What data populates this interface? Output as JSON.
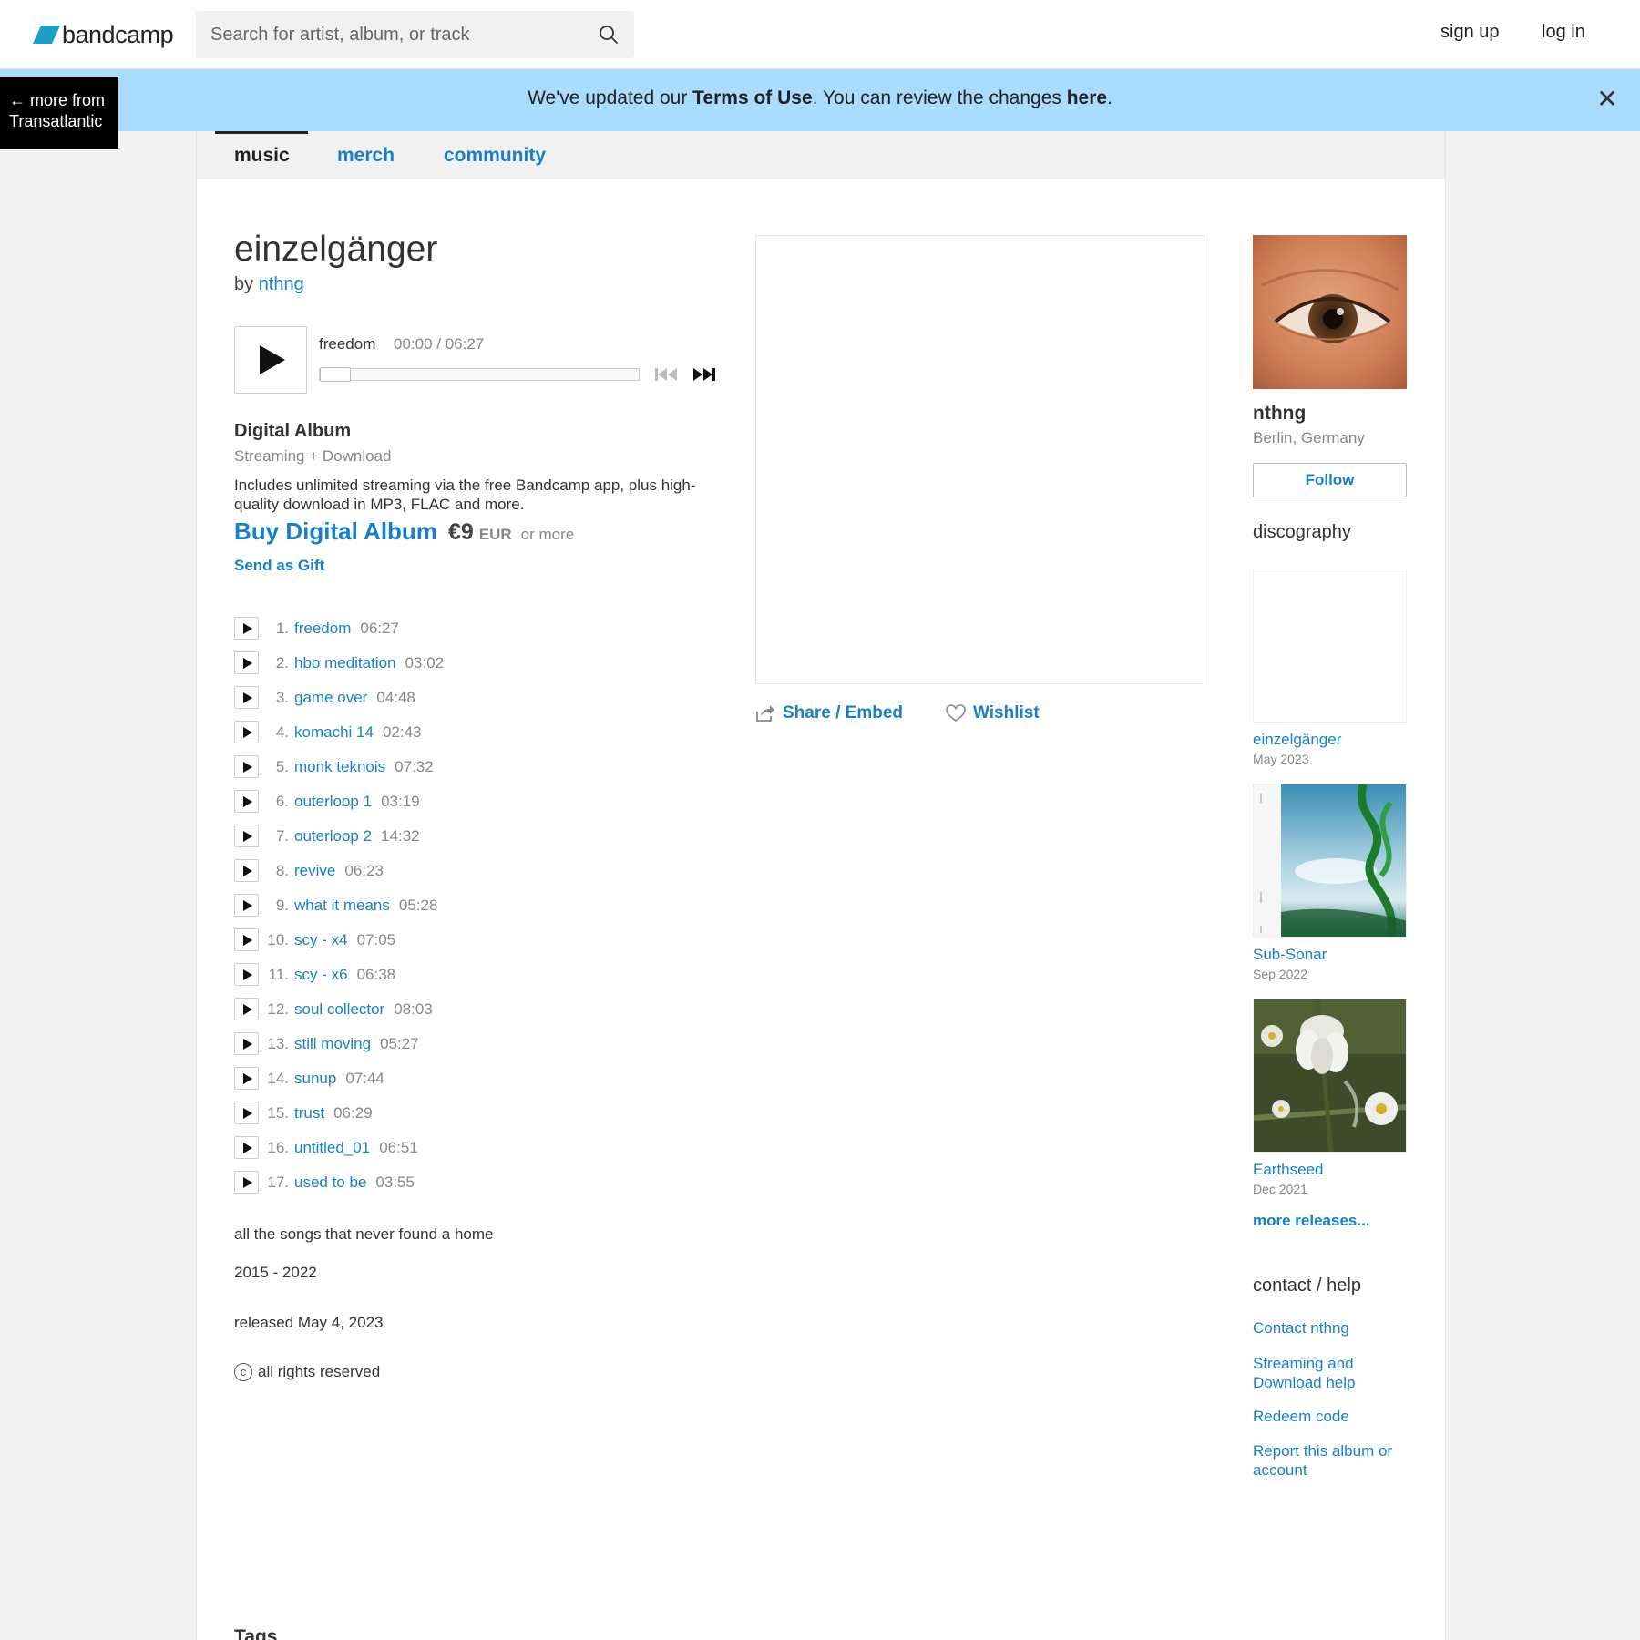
{
  "header": {
    "logo_text": "bandcamp",
    "search_placeholder": "Search for artist, album, or track",
    "signup_label": "sign up",
    "login_label": "log in"
  },
  "banner": {
    "text_before": "We've updated our ",
    "terms_label": "Terms of Use",
    "text_middle": ". You can review the changes ",
    "here_label": "here",
    "text_after": ".",
    "close_label": "✕"
  },
  "more_from": {
    "line1": "← more from",
    "line2": "Transatlantic"
  },
  "tabs": [
    {
      "label": "music"
    },
    {
      "label": "merch"
    },
    {
      "label": "community"
    }
  ],
  "album": {
    "title": "einzelgänger",
    "by_prefix": "by ",
    "artist": "nthng",
    "description": "all the songs that never found a home",
    "years": "2015 - 2022",
    "released": "released May 4, 2023",
    "rights": "all rights reserved",
    "copyright_symbol": "c",
    "tags_heading": "Tags"
  },
  "player": {
    "current_title": "freedom",
    "current_time": "00:00 / 06:27",
    "progress": 0
  },
  "purchase": {
    "format_title": "Digital Album",
    "format_sub": "Streaming + Download",
    "description": "Includes unlimited streaming via the free Bandcamp app, plus high-quality download in MP3, FLAC and more.",
    "buy_label": "Buy Digital Album",
    "price": "€9",
    "currency": "EUR",
    "or_more": "or more",
    "gift_label": "Send as Gift"
  },
  "tracks": [
    {
      "num": "1.",
      "title": "freedom",
      "duration": "06:27"
    },
    {
      "num": "2.",
      "title": "hbo meditation",
      "duration": "03:02"
    },
    {
      "num": "3.",
      "title": "game over",
      "duration": "04:48"
    },
    {
      "num": "4.",
      "title": "komachi 14",
      "duration": "02:43"
    },
    {
      "num": "5.",
      "title": "monk teknois",
      "duration": "07:32"
    },
    {
      "num": "6.",
      "title": "outerloop 1",
      "duration": "03:19"
    },
    {
      "num": "7.",
      "title": "outerloop 2",
      "duration": "14:32"
    },
    {
      "num": "8.",
      "title": "revive",
      "duration": "06:23"
    },
    {
      "num": "9.",
      "title": "what it means",
      "duration": "05:28"
    },
    {
      "num": "10.",
      "title": "scy - x4",
      "duration": "07:05"
    },
    {
      "num": "11.",
      "title": "scy - x6",
      "duration": "06:38"
    },
    {
      "num": "12.",
      "title": "soul collector",
      "duration": "08:03"
    },
    {
      "num": "13.",
      "title": "still moving",
      "duration": "05:27"
    },
    {
      "num": "14.",
      "title": "sunup",
      "duration": "07:44"
    },
    {
      "num": "15.",
      "title": "trust",
      "duration": "06:29"
    },
    {
      "num": "16.",
      "title": "untitled_01",
      "duration": "06:51"
    },
    {
      "num": "17.",
      "title": "used to be",
      "duration": "03:55"
    }
  ],
  "actions": {
    "share_label": "Share / Embed",
    "wishlist_label": "Wishlist"
  },
  "sidebar": {
    "artist_name": "nthng",
    "location": "Berlin, Germany",
    "follow_label": "Follow",
    "discography_heading": "discography",
    "discography": [
      {
        "title": "einzelgänger",
        "date": "May 2023"
      },
      {
        "title": "Sub-Sonar",
        "date": "Sep 2022"
      },
      {
        "title": "Earthseed",
        "date": "Dec 2021"
      }
    ],
    "more_releases_label": "more releases...",
    "contact_heading": "contact / help",
    "help_links": [
      {
        "label": "Contact nthng"
      },
      {
        "label": "Streaming and Download help"
      },
      {
        "label": "Redeem code"
      },
      {
        "label": "Report this album or account"
      }
    ]
  },
  "colors": {
    "link": "#1a7fc9",
    "banner": "#aadcff",
    "logo": "#1da0c3"
  }
}
